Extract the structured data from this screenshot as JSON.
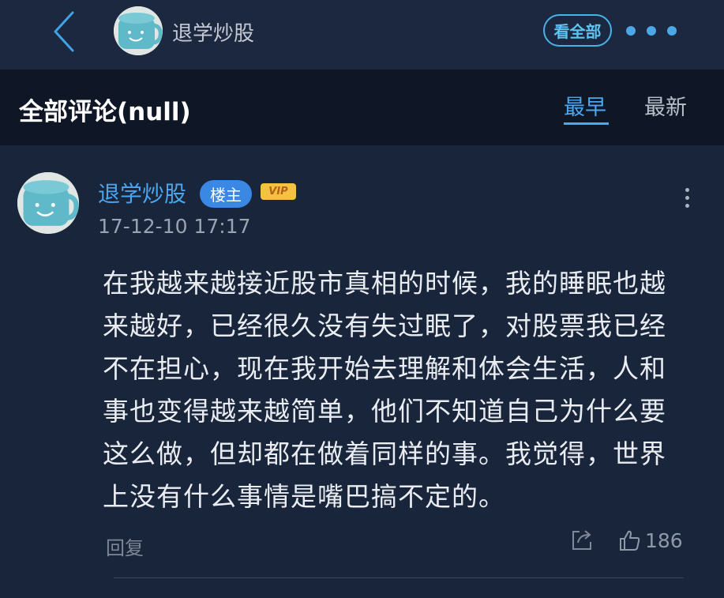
{
  "topbar": {
    "username": "退学炒股",
    "see_all_label": "看全部"
  },
  "section": {
    "title": "全部评论(null)",
    "tabs": [
      {
        "label": "最早",
        "active": true
      },
      {
        "label": "最新",
        "active": false
      }
    ]
  },
  "comment": {
    "username": "退学炒股",
    "owner_badge": "楼主",
    "vip_badge": "VIP",
    "time": "17-12-10 17:17",
    "lines": [
      "在我越来越接近股市真相的时候，我的睡眠也越",
      "来越好，已经很久没有失过眠了，对股票我已经",
      "不在担心，现在我开始去理解和体会生活，人和",
      "事也变得越来越简单，他们不知道自己为什么要",
      "这么做，但却都在做着同样的事。我觉得，世界",
      "上没有什么事情是嘴巴搞不定的。"
    ],
    "reply_label": "回复",
    "like_count": "186"
  },
  "colors": {
    "accent": "#4aa8f0",
    "background": "#19253b",
    "header_background": "#0f1726",
    "vip": "#f3c23f"
  },
  "icons": [
    "back-chevron-icon",
    "more-dots-icon",
    "share-icon",
    "thumbs-up-icon",
    "kebab-menu-icon",
    "mug-avatar"
  ]
}
